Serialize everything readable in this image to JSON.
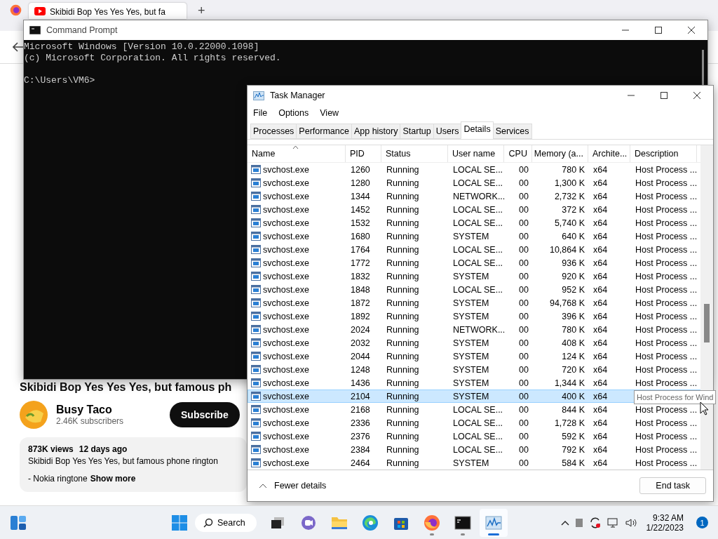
{
  "browser": {
    "tab_title": "Skibidi Bop Yes Yes Yes, but fa",
    "new_tab": "+",
    "video": {
      "title": "Skibidi Bop Yes Yes Yes, but famous ph",
      "channel": "Busy Taco",
      "subscribers": "2.46K subscribers",
      "subscribe": "Subscribe",
      "views": "873K views",
      "age": "12 days ago",
      "description": "Skibidi Bop Yes Yes Yes, but famous phone rington",
      "description_more": "- Nokia ringtone",
      "show_more": "Show more"
    }
  },
  "command_prompt": {
    "title": "Command Prompt",
    "banner": [
      "Microsoft Windows [Version 10.0.22000.1098]",
      "(c) Microsoft Corporation. All rights reserved."
    ],
    "prompt": "C:\\Users\\VM6>"
  },
  "task_manager": {
    "title": "Task Manager",
    "menu": [
      "File",
      "Options",
      "View"
    ],
    "tabs": [
      {
        "label": "Processes",
        "selected": false
      },
      {
        "label": "Performance",
        "selected": false
      },
      {
        "label": "App history",
        "selected": false
      },
      {
        "label": "Startup",
        "selected": false
      },
      {
        "label": "Users",
        "selected": false
      },
      {
        "label": "Details",
        "selected": true
      },
      {
        "label": "Services",
        "selected": false
      }
    ],
    "columns": [
      "Name",
      "PID",
      "Status",
      "User name",
      "CPU",
      "Memory (a...",
      "Archite...",
      "Description"
    ],
    "rows": [
      {
        "name": "svchost.exe",
        "pid": "1260",
        "status": "Running",
        "user": "LOCAL SE...",
        "cpu": "00",
        "memory": "780 K",
        "arch": "x64",
        "description": "Host Process ...",
        "selected": false
      },
      {
        "name": "svchost.exe",
        "pid": "1280",
        "status": "Running",
        "user": "LOCAL SE...",
        "cpu": "00",
        "memory": "1,300 K",
        "arch": "x64",
        "description": "Host Process ...",
        "selected": false
      },
      {
        "name": "svchost.exe",
        "pid": "1344",
        "status": "Running",
        "user": "NETWORK...",
        "cpu": "00",
        "memory": "2,732 K",
        "arch": "x64",
        "description": "Host Process ...",
        "selected": false
      },
      {
        "name": "svchost.exe",
        "pid": "1452",
        "status": "Running",
        "user": "LOCAL SE...",
        "cpu": "00",
        "memory": "372 K",
        "arch": "x64",
        "description": "Host Process ...",
        "selected": false
      },
      {
        "name": "svchost.exe",
        "pid": "1532",
        "status": "Running",
        "user": "LOCAL SE...",
        "cpu": "00",
        "memory": "5,740 K",
        "arch": "x64",
        "description": "Host Process ...",
        "selected": false
      },
      {
        "name": "svchost.exe",
        "pid": "1680",
        "status": "Running",
        "user": "SYSTEM",
        "cpu": "00",
        "memory": "640 K",
        "arch": "x64",
        "description": "Host Process ...",
        "selected": false
      },
      {
        "name": "svchost.exe",
        "pid": "1764",
        "status": "Running",
        "user": "LOCAL SE...",
        "cpu": "00",
        "memory": "10,864 K",
        "arch": "x64",
        "description": "Host Process ...",
        "selected": false
      },
      {
        "name": "svchost.exe",
        "pid": "1772",
        "status": "Running",
        "user": "LOCAL SE...",
        "cpu": "00",
        "memory": "936 K",
        "arch": "x64",
        "description": "Host Process ...",
        "selected": false
      },
      {
        "name": "svchost.exe",
        "pid": "1832",
        "status": "Running",
        "user": "SYSTEM",
        "cpu": "00",
        "memory": "920 K",
        "arch": "x64",
        "description": "Host Process ...",
        "selected": false
      },
      {
        "name": "svchost.exe",
        "pid": "1848",
        "status": "Running",
        "user": "LOCAL SE...",
        "cpu": "00",
        "memory": "952 K",
        "arch": "x64",
        "description": "Host Process ...",
        "selected": false
      },
      {
        "name": "svchost.exe",
        "pid": "1872",
        "status": "Running",
        "user": "SYSTEM",
        "cpu": "00",
        "memory": "94,768 K",
        "arch": "x64",
        "description": "Host Process ...",
        "selected": false
      },
      {
        "name": "svchost.exe",
        "pid": "1892",
        "status": "Running",
        "user": "SYSTEM",
        "cpu": "00",
        "memory": "396 K",
        "arch": "x64",
        "description": "Host Process ...",
        "selected": false
      },
      {
        "name": "svchost.exe",
        "pid": "2024",
        "status": "Running",
        "user": "NETWORK...",
        "cpu": "00",
        "memory": "780 K",
        "arch": "x64",
        "description": "Host Process ...",
        "selected": false
      },
      {
        "name": "svchost.exe",
        "pid": "2032",
        "status": "Running",
        "user": "SYSTEM",
        "cpu": "00",
        "memory": "408 K",
        "arch": "x64",
        "description": "Host Process ...",
        "selected": false
      },
      {
        "name": "svchost.exe",
        "pid": "2044",
        "status": "Running",
        "user": "SYSTEM",
        "cpu": "00",
        "memory": "124 K",
        "arch": "x64",
        "description": "Host Process ...",
        "selected": false
      },
      {
        "name": "svchost.exe",
        "pid": "1248",
        "status": "Running",
        "user": "SYSTEM",
        "cpu": "00",
        "memory": "720 K",
        "arch": "x64",
        "description": "Host Process ...",
        "selected": false
      },
      {
        "name": "svchost.exe",
        "pid": "1436",
        "status": "Running",
        "user": "SYSTEM",
        "cpu": "00",
        "memory": "1,344 K",
        "arch": "x64",
        "description": "Host Process ...",
        "selected": false
      },
      {
        "name": "svchost.exe",
        "pid": "2104",
        "status": "Running",
        "user": "SYSTEM",
        "cpu": "00",
        "memory": "400 K",
        "arch": "x64",
        "selected": true
      },
      {
        "name": "svchost.exe",
        "pid": "2168",
        "status": "Running",
        "user": "LOCAL SE...",
        "cpu": "00",
        "memory": "844 K",
        "arch": "x64",
        "description": "Host Process ...",
        "selected": false
      },
      {
        "name": "svchost.exe",
        "pid": "2336",
        "status": "Running",
        "user": "LOCAL SE...",
        "cpu": "00",
        "memory": "1,728 K",
        "arch": "x64",
        "description": "Host Process ...",
        "selected": false
      },
      {
        "name": "svchost.exe",
        "pid": "2376",
        "status": "Running",
        "user": "LOCAL SE...",
        "cpu": "00",
        "memory": "592 K",
        "arch": "x64",
        "description": "Host Process ...",
        "selected": false
      },
      {
        "name": "svchost.exe",
        "pid": "2384",
        "status": "Running",
        "user": "LOCAL SE...",
        "cpu": "00",
        "memory": "792 K",
        "arch": "x64",
        "description": "Host Process ...",
        "selected": false
      },
      {
        "name": "svchost.exe",
        "pid": "2464",
        "status": "Running",
        "user": "SYSTEM",
        "cpu": "00",
        "memory": "584 K",
        "arch": "x64",
        "description": "Host Process ...",
        "selected": false
      }
    ],
    "tooltip": "Host Process for Wind",
    "fewer_details": "Fewer details",
    "end_task": "End task"
  },
  "taskbar": {
    "search": "Search",
    "apps": [
      {
        "kind": "taskview",
        "running": false,
        "active": false
      },
      {
        "kind": "chat",
        "running": false,
        "active": false
      },
      {
        "kind": "explorer",
        "running": false,
        "active": false
      },
      {
        "kind": "edge",
        "running": false,
        "active": false
      },
      {
        "kind": "store",
        "running": false,
        "active": false
      },
      {
        "kind": "firefox",
        "running": true,
        "active": false
      },
      {
        "kind": "terminal",
        "running": true,
        "active": false
      },
      {
        "kind": "monitor",
        "running": true,
        "active": true
      }
    ],
    "time": "9:32 AM",
    "date": "1/22/2023",
    "notifications": "1"
  }
}
